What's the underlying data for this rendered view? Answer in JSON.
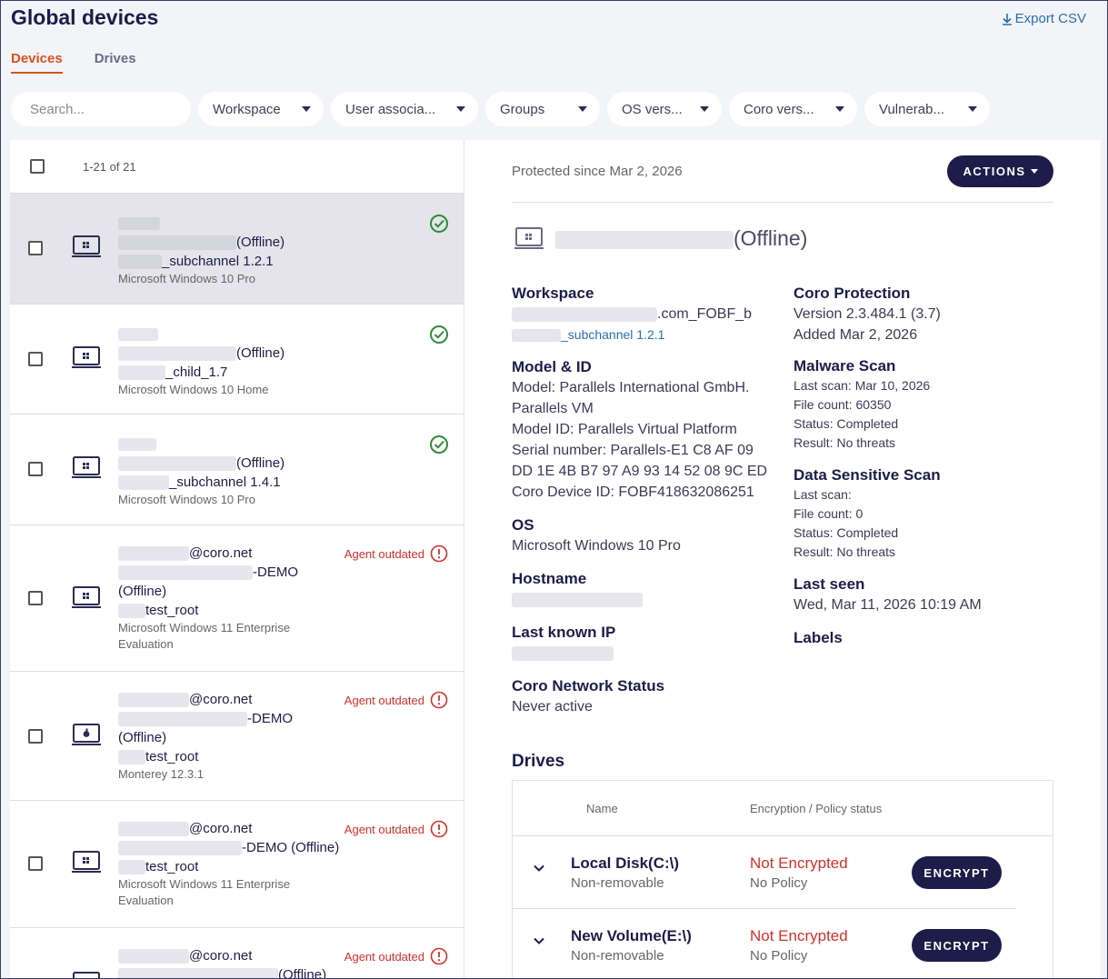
{
  "header": {
    "title": "Global devices",
    "export_label": "Export CSV"
  },
  "tabs": [
    {
      "label": "Devices"
    },
    {
      "label": "Drives"
    }
  ],
  "filters": {
    "search_placeholder": "Search...",
    "items": [
      {
        "label": "Workspace"
      },
      {
        "label": "User associa..."
      },
      {
        "label": "Groups"
      },
      {
        "label": "OS vers..."
      },
      {
        "label": "Coro vers..."
      },
      {
        "label": "Vulnerab..."
      }
    ]
  },
  "list": {
    "count": "1-21 of 21",
    "rows": [
      {
        "l1_suffix": "(Offline)",
        "l2_suffix": "_subchannel 1.2.1",
        "os": "Microsoft Windows 10 Pro"
      },
      {
        "l1_suffix": "(Offline)",
        "l2_suffix": "_child_1.7",
        "os": "Microsoft Windows 10 Home"
      },
      {
        "l1_suffix": "(Offline)",
        "l2_suffix": "_subchannel 1.4.1",
        "os": "Microsoft Windows 10 Pro"
      },
      {
        "user": "@coro.net",
        "host": "-DEMO",
        "offline": "(Offline)",
        "ws": "test_root",
        "os": "Microsoft Windows 11 Enterprise",
        "os2": "Evaluation",
        "status": "Agent outdated"
      },
      {
        "user": "@coro.net",
        "host": "-DEMO",
        "offline": "(Offline)",
        "ws": "test_root",
        "os": "Monterey 12.3.1",
        "status": "Agent outdated"
      },
      {
        "user": "@coro.net",
        "host": "-DEMO (Offline)",
        "ws": "test_root",
        "os": "Microsoft Windows 11 Enterprise",
        "os2": "Evaluation",
        "status": "Agent outdated"
      },
      {
        "user": "@coro.net",
        "host": "(Offline)",
        "status": "Agent outdated"
      }
    ]
  },
  "detail": {
    "protected_since": "Protected since Mar 2, 2026",
    "actions_label": "ACTIONS",
    "device_status": "(Offline)",
    "workspace": {
      "heading": "Workspace",
      "value_suffix": ".com_FOBF_b",
      "link_suffix": "_subchannel 1.2.1"
    },
    "model": {
      "heading": "Model & ID",
      "lines": [
        "Model: Parallels International GmbH.",
        "Parallels VM",
        "Model ID: Parallels Virtual Platform",
        "Serial number: Parallels-E1 C8 AF 09",
        "DD 1E 4B B7 97 A9 93 14 52 08 9C ED",
        "Coro Device ID: FOBF418632086251"
      ]
    },
    "os": {
      "heading": "OS",
      "value": "Microsoft Windows 10 Pro"
    },
    "hostname": {
      "heading": "Hostname"
    },
    "last_ip": {
      "heading": "Last known IP"
    },
    "network": {
      "heading": "Coro Network Status",
      "value": "Never active"
    },
    "protection": {
      "heading": "Coro Protection",
      "version": "Version 2.3.484.1 (3.7)",
      "added": "Added Mar 2, 2026"
    },
    "malware": {
      "heading": "Malware Scan",
      "lines": [
        "Last scan: Mar 10, 2026",
        "File count: 60350",
        "Status: Completed",
        "Result: No threats"
      ]
    },
    "dss": {
      "heading": "Data Sensitive Scan",
      "lines": [
        "Last scan:",
        "File count: 0",
        "Status: Completed",
        "Result: No threats"
      ]
    },
    "last_seen": {
      "heading": "Last seen",
      "value": "Wed, Mar 11, 2026 10:19 AM"
    },
    "labels": {
      "heading": "Labels"
    },
    "drives": {
      "heading": "Drives",
      "col_name": "Name",
      "col_status": "Encryption / Policy status",
      "rows": [
        {
          "name": "Local Disk(C:\\)",
          "type": "Non-removable",
          "status": "Not Encrypted",
          "policy": "No Policy",
          "button": "ENCRYPT"
        },
        {
          "name": "New Volume(E:\\)",
          "type": "Non-removable",
          "status": "Not Encrypted",
          "policy": "No Policy",
          "button": "ENCRYPT"
        }
      ]
    }
  },
  "colors": {
    "primary": "#1e1c48",
    "accent": "#d8531c",
    "link": "#2a6fb0",
    "danger": "#d0312d",
    "ok": "#2e8b3a"
  }
}
